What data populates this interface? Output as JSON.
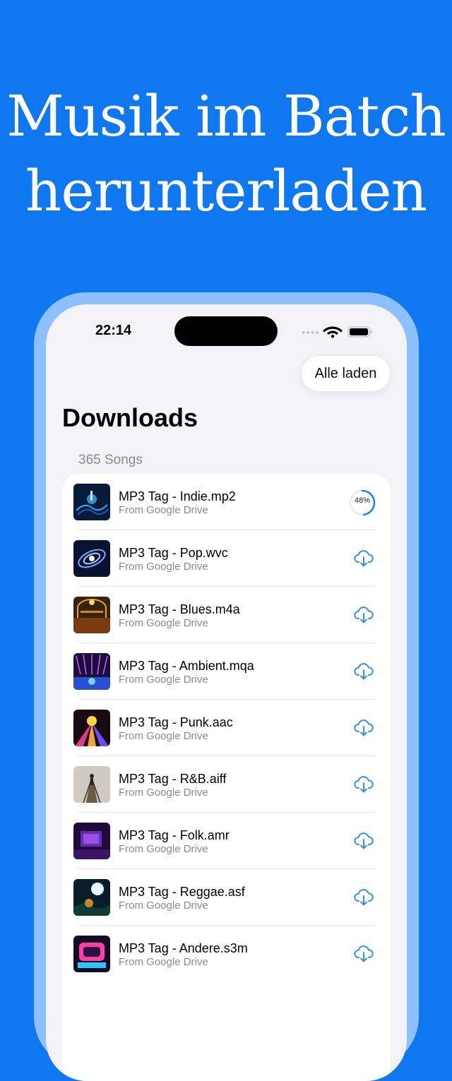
{
  "headline": {
    "line1": "Musik im Batch",
    "line2": "herunterladen"
  },
  "status_bar": {
    "time": "22:14"
  },
  "toolbar": {
    "load_all_label": "Alle laden"
  },
  "page": {
    "title": "Downloads",
    "section_label": "365 Songs"
  },
  "colors": {
    "accent": "#0f77f0",
    "progress": "#1a7ff0",
    "icon": "#3b8fe0"
  },
  "songs": [
    {
      "title": "MP3 Tag - Indie.mp2",
      "source": "From Google Drive",
      "state": "downloading",
      "progress_label": "48%",
      "progress": 0.48,
      "icon": "progress-ring"
    },
    {
      "title": "MP3 Tag - Pop.wvc",
      "source": "From Google Drive",
      "state": "idle",
      "icon": "cloud-download-icon"
    },
    {
      "title": "MP3 Tag - Blues.m4a",
      "source": "From Google Drive",
      "state": "idle",
      "icon": "cloud-download-icon"
    },
    {
      "title": "MP3 Tag - Ambient.mqa",
      "source": "From Google Drive",
      "state": "idle",
      "icon": "cloud-download-icon"
    },
    {
      "title": "MP3 Tag - Punk.aac",
      "source": "From Google Drive",
      "state": "idle",
      "icon": "cloud-download-icon"
    },
    {
      "title": "MP3 Tag - R&B.aiff",
      "source": "From Google Drive",
      "state": "idle",
      "icon": "cloud-download-icon"
    },
    {
      "title": "MP3 Tag - Folk.amr",
      "source": "From Google Drive",
      "state": "idle",
      "icon": "cloud-download-icon"
    },
    {
      "title": "MP3 Tag - Reggae.asf",
      "source": "From Google Drive",
      "state": "idle",
      "icon": "cloud-download-icon"
    },
    {
      "title": "MP3 Tag - Andere.s3m",
      "source": "From Google Drive",
      "state": "idle",
      "icon": "cloud-download-icon"
    }
  ]
}
